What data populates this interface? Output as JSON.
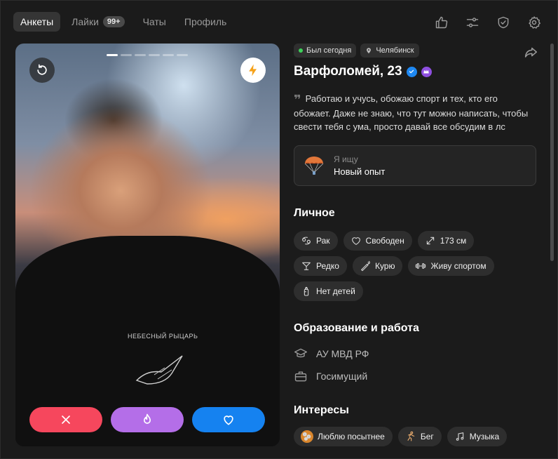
{
  "nav": {
    "tabs": [
      {
        "label": "Анкеты",
        "active": true
      },
      {
        "label": "Лайки",
        "badge": "99+"
      },
      {
        "label": "Чаты"
      },
      {
        "label": "Профиль"
      }
    ],
    "icons": [
      "thumbs-up-icon",
      "sliders-icon",
      "shield-check-icon",
      "gear-icon"
    ]
  },
  "photo": {
    "total_photos": 6,
    "current_photo": 1,
    "shirt_text": "НЕБЕСНЫЙ РЫЦАРЬ"
  },
  "profile": {
    "status": "Был сегодня",
    "city": "Челябинск",
    "name": "Варфоломей, 23",
    "bio": "Работаю и учусь, обожаю спорт и тех, кто его обожает. Даже не знаю, что тут можно написать, чтобы свести тебя с ума, просто давай все обсудим в лс",
    "looking_label": "Я ищу",
    "looking_value": "Новый опыт"
  },
  "personal": {
    "title": "Личное",
    "chips": [
      {
        "icon": "cancer-zodiac-icon",
        "label": "Рак"
      },
      {
        "icon": "heart-outline-icon",
        "label": "Свободен"
      },
      {
        "icon": "height-arrows-icon",
        "label": "173 см"
      },
      {
        "icon": "cocktail-glass-icon",
        "label": "Редко"
      },
      {
        "icon": "cigarette-icon",
        "label": "Курю"
      },
      {
        "icon": "dumbbell-icon",
        "label": "Живу спортом"
      },
      {
        "icon": "baby-bottle-icon",
        "label": "Нет детей"
      }
    ]
  },
  "education": {
    "title": "Образование и работа",
    "school": "АУ МВД РФ",
    "work": "Госимущий"
  },
  "interests": {
    "title": "Интересы",
    "chips": [
      {
        "icon": "cookie-icon",
        "label": "Люблю посытнее"
      },
      {
        "icon": "runner-icon",
        "label": "Бег"
      },
      {
        "icon": "music-notes-icon",
        "label": "Музыка"
      }
    ]
  },
  "colors": {
    "skip": "#f6475d",
    "super": "#b46ee8",
    "like": "#1582f0",
    "online": "#3ed15a",
    "verified": "#1e88f2",
    "premium": "#8e4fe0"
  }
}
